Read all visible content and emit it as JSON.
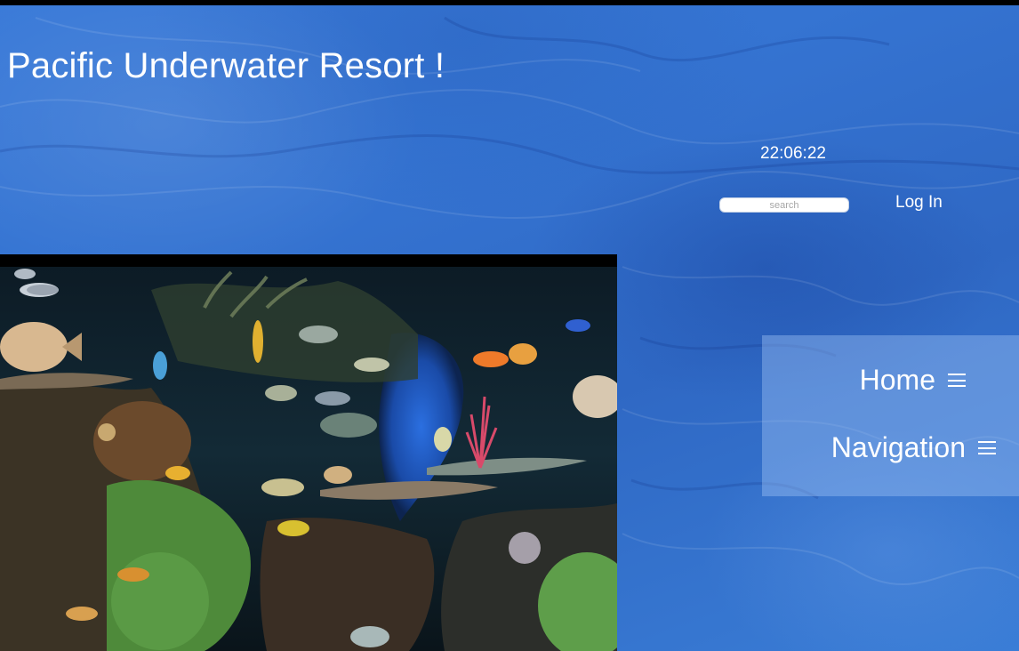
{
  "site": {
    "title": "Pacific Underwater Resort !"
  },
  "header": {
    "clock": "22:06:22",
    "search_placeholder": "search",
    "login_label": "Log In"
  },
  "nav": {
    "items": [
      {
        "label": "Home",
        "icon": "hamburger-menu-icon"
      },
      {
        "label": "Navigation",
        "icon": "hamburger-menu-icon"
      }
    ]
  },
  "media": {
    "video_subject": "aquarium-coral-reef"
  },
  "colors": {
    "background_blue": "#3574d2",
    "panel": "#a0c3f5",
    "text": "#ffffff"
  }
}
